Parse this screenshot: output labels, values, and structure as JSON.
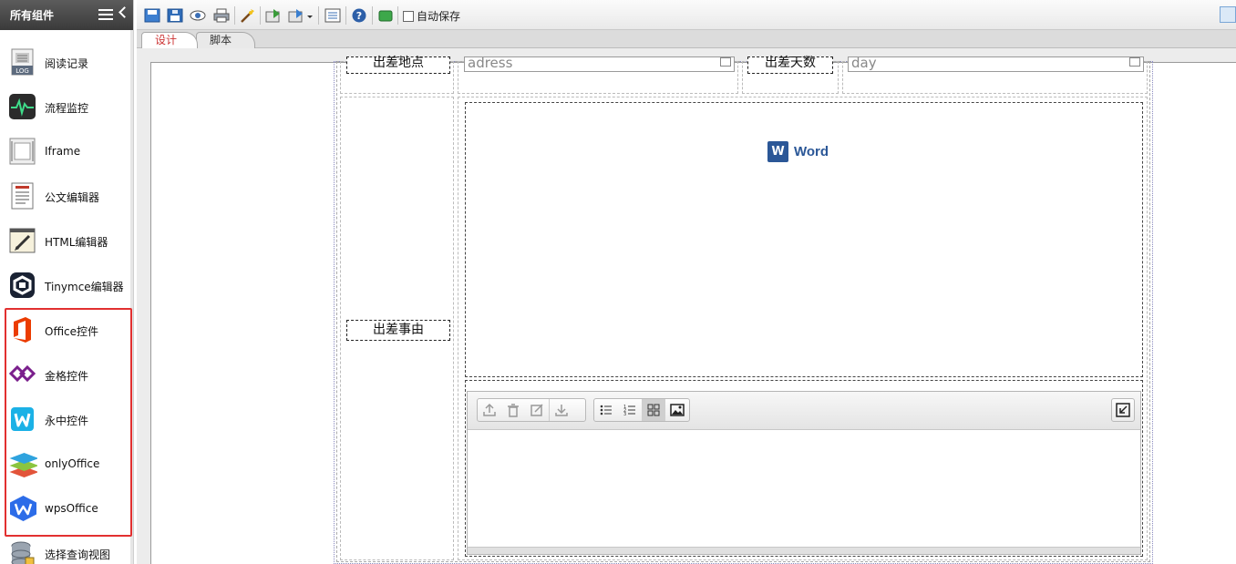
{
  "sidebar": {
    "title": "所有组件",
    "items": [
      {
        "label": "阅读记录",
        "icon": "log-file-icon"
      },
      {
        "label": "流程监控",
        "icon": "pulse-monitor-icon"
      },
      {
        "label": "Iframe",
        "icon": "iframe-icon"
      },
      {
        "label": "公文编辑器",
        "icon": "document-editor-icon"
      },
      {
        "label": "HTML编辑器",
        "icon": "html-editor-icon"
      },
      {
        "label": "Tinymce编辑器",
        "icon": "tinymce-icon"
      },
      {
        "label": "Office控件",
        "icon": "office-icon"
      },
      {
        "label": "金格控件",
        "icon": "jinge-icon"
      },
      {
        "label": "永中控件",
        "icon": "yozo-icon"
      },
      {
        "label": "onlyOffice",
        "icon": "onlyoffice-icon"
      },
      {
        "label": "wpsOffice",
        "icon": "wps-icon"
      },
      {
        "label": "选择查询视图",
        "icon": "database-icon"
      }
    ]
  },
  "toolbar": {
    "autosave_label": "自动保存"
  },
  "tabs": [
    {
      "label": "设计",
      "active": true
    },
    {
      "label": "脚本",
      "active": false
    }
  ],
  "form": {
    "row1": {
      "label1": "出差地点",
      "field1_value": "adress",
      "label2": "出差天数",
      "field2_value": "day"
    },
    "row2": {
      "label": "出差事由",
      "word_label": "Word"
    }
  },
  "colors": {
    "highlight": "#e23030",
    "word_blue": "#2b5797",
    "active_tab_text": "#cc3333"
  }
}
